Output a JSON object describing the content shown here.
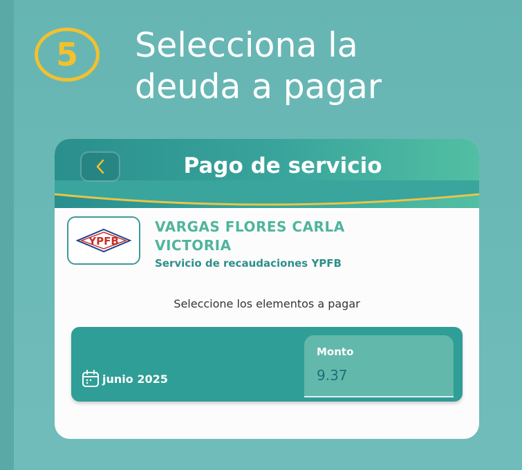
{
  "step": {
    "number": "5",
    "title_line1": "Selecciona la",
    "title_line2": "deuda a pagar"
  },
  "header": {
    "title": "Pago de servicio",
    "back_icon": "chevron-left-icon"
  },
  "client": {
    "logo_text": "YPFB",
    "name_line1": "VARGAS FLORES CARLA",
    "name_line2": "VICTORIA",
    "service": "Servicio de recaudaciones YPFB"
  },
  "instructions": "Seleccione los elementos a pagar",
  "debts": [
    {
      "period": "junio 2025",
      "period_icon": "calendar-icon",
      "amount_label": "Monto",
      "amount": "9.37"
    }
  ],
  "colors": {
    "background": "#6bb8b6",
    "accent_yellow": "#f2c12e",
    "header_teal": "#2a8f8d",
    "client_green": "#4eb59c",
    "row_teal": "#2f9e96"
  }
}
